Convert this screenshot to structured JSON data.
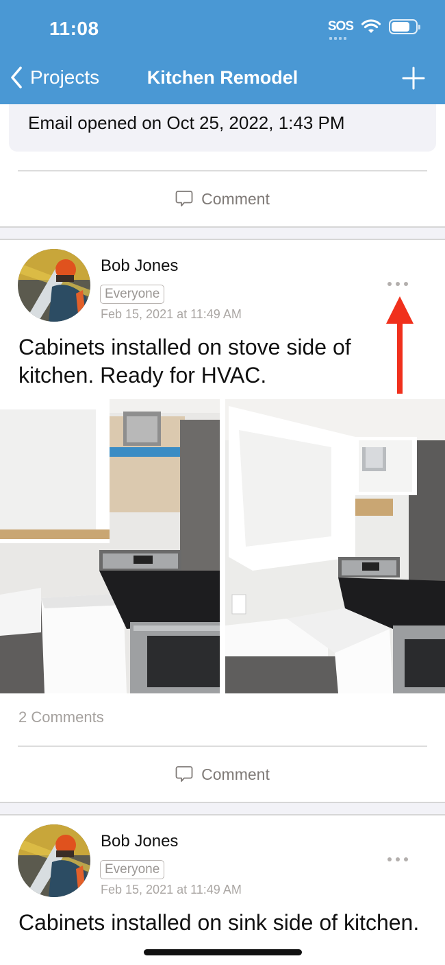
{
  "status_bar": {
    "time": "11:08",
    "carrier": "SOS",
    "icons": [
      "wifi-icon",
      "battery-icon"
    ],
    "battery_level": 0.75
  },
  "nav": {
    "back_label": "Projects",
    "title": "Kitchen Remodel",
    "add_icon": "plus-icon",
    "back_icon": "chevron-left-icon"
  },
  "colors": {
    "header_bg": "#4a98d4",
    "annotation_arrow": "#f0301c",
    "secondary_text": "#a5a19e"
  },
  "email_card": {
    "text": "Email opened on Oct 25, 2022, 1:43 PM"
  },
  "comment_action_label": "Comment",
  "posts": [
    {
      "author": "Bob Jones",
      "audience": "Everyone",
      "timestamp": "Feb 15, 2021 at 11:49 AM",
      "text": "Cabinets installed on stove side of kitchen. Ready for HVAC.",
      "photos": [
        {
          "description": "Open upper cabinet, vent duct and electric stove"
        },
        {
          "description": "Upper cabinets with vent duct above stove and outlet on wall"
        }
      ],
      "comments_count_label": "2 Comments",
      "comment_label": "Comment"
    },
    {
      "author": "Bob Jones",
      "audience": "Everyone",
      "timestamp": "Feb 15, 2021 at 11:49 AM",
      "text": "Cabinets installed on sink side of kitchen."
    }
  ]
}
